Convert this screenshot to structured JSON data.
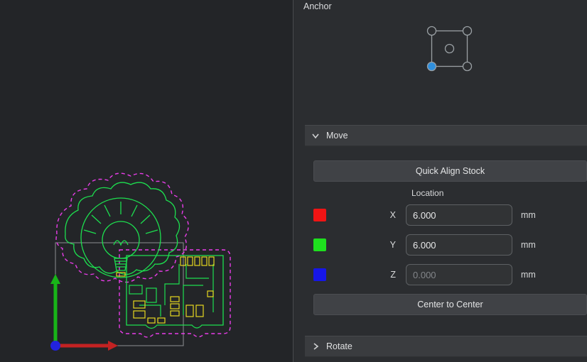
{
  "panel": {
    "anchor_label": "Anchor",
    "move": {
      "label": "Move",
      "quick_align_label": "Quick Align Stock",
      "location_label": "Location",
      "rows": [
        {
          "axis": "X",
          "value": "6.000",
          "unit": "mm",
          "swatch": "#f01414"
        },
        {
          "axis": "Y",
          "value": "6.000",
          "unit": "mm",
          "swatch": "#1ee01e"
        },
        {
          "axis": "Z",
          "placeholder": "0.000",
          "unit": "mm",
          "swatch": "#1616e8"
        }
      ],
      "center_label": "Center to Center"
    },
    "rotate": {
      "label": "Rotate"
    }
  },
  "anchor_widget": {
    "selected_point": "bottom-left",
    "selected_color": "#2f8fdd",
    "outline_color": "#9aa0a4"
  },
  "viewport": {
    "colors": {
      "background": "#232528",
      "outline_offset_magenta": "#e93de9",
      "geometry_green": "#1ddf4f",
      "pads_yellow": "#e6d820",
      "stock_gray": "#8d9092",
      "axis_x_red": "#c32222",
      "axis_y_green": "#18b418",
      "origin_blue": "#2222dd"
    }
  }
}
